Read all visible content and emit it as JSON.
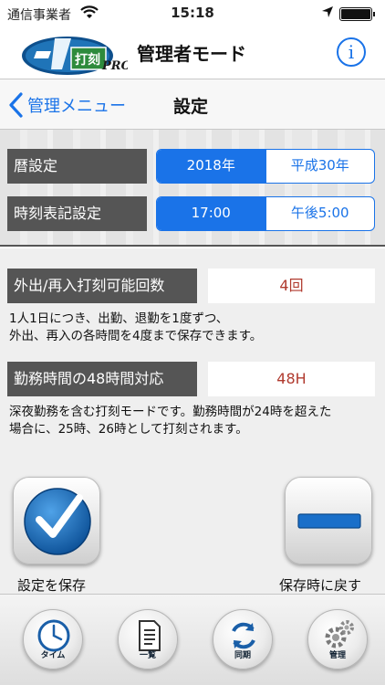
{
  "status_bar": {
    "carrier": "通信事業者",
    "time": "15:18"
  },
  "header": {
    "logo_text": "打刻",
    "logo_pro": "PRO",
    "title": "管理者モード",
    "info_label": "i"
  },
  "nav": {
    "back_label": "管理メニュー",
    "title": "設定"
  },
  "calendar": {
    "label": "暦設定",
    "options": [
      "2018年",
      "平成30年"
    ],
    "selected": 0
  },
  "time_format": {
    "label": "時刻表記設定",
    "options": [
      "17:00",
      "午後5:00"
    ],
    "selected": 0
  },
  "punch_count": {
    "label": "外出/再入打刻可能回数",
    "value": "4回",
    "description_lines": [
      "1人1日につき、出勤、退勤を1度ずつ、",
      "外出、再入の各時間を4度まで保存できます。"
    ]
  },
  "hours48": {
    "label": "勤務時間の48時間対応",
    "value": "48H",
    "description_lines": [
      "深夜勤務を含む打刻モードです。勤務時間が24時を超えた",
      "場合に、25時、26時として打刻されます。"
    ]
  },
  "actions": {
    "save_label": "設定を保存",
    "revert_label": "保存時に戻す"
  },
  "tabs": [
    {
      "label": "タイム",
      "icon": "clock-icon"
    },
    {
      "label": "一覧",
      "icon": "document-list-icon"
    },
    {
      "label": "同期",
      "icon": "sync-icon"
    },
    {
      "label": "管理",
      "icon": "gears-icon"
    }
  ],
  "colors": {
    "accent": "#1a73e8",
    "value_text": "#b03a2e",
    "label_bg": "#555555"
  }
}
